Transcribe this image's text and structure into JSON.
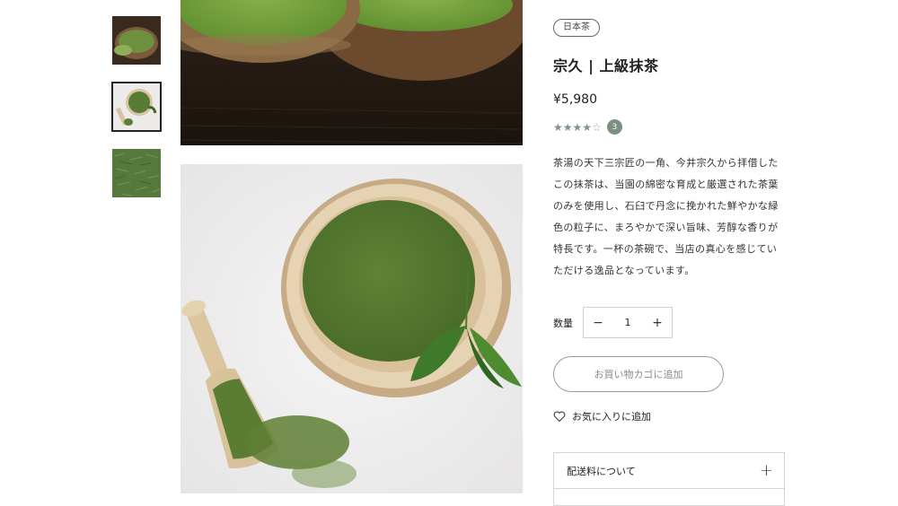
{
  "product": {
    "category_tag": "日本茶",
    "title": "宗久 | 上級抹茶",
    "price": "¥5,980",
    "rating": 4,
    "rating_max": 5,
    "review_count": "3",
    "description": "茶湯の天下三宗匠の一角、今井宗久から拝借したこの抹茶は、当園の綿密な育成と厳選された茶葉のみを使用し、石臼で丹念に挽かれた鮮やかな緑色の粒子に、まろやかで深い旨味、芳醇な香りが特長です。一杯の茶碗で、当店の真心を感じていただける逸品となっています。"
  },
  "quantity": {
    "label": "数量",
    "value": "1",
    "minus": "−",
    "plus": "+"
  },
  "actions": {
    "add_to_cart": "お買い物カゴに追加",
    "favorite": "お気に入りに追加"
  },
  "accordion": {
    "shipping_label": "配送料について",
    "toggle": "+"
  },
  "colors": {
    "accent": "#7d8f80",
    "matcha": "#5a7a3a"
  }
}
